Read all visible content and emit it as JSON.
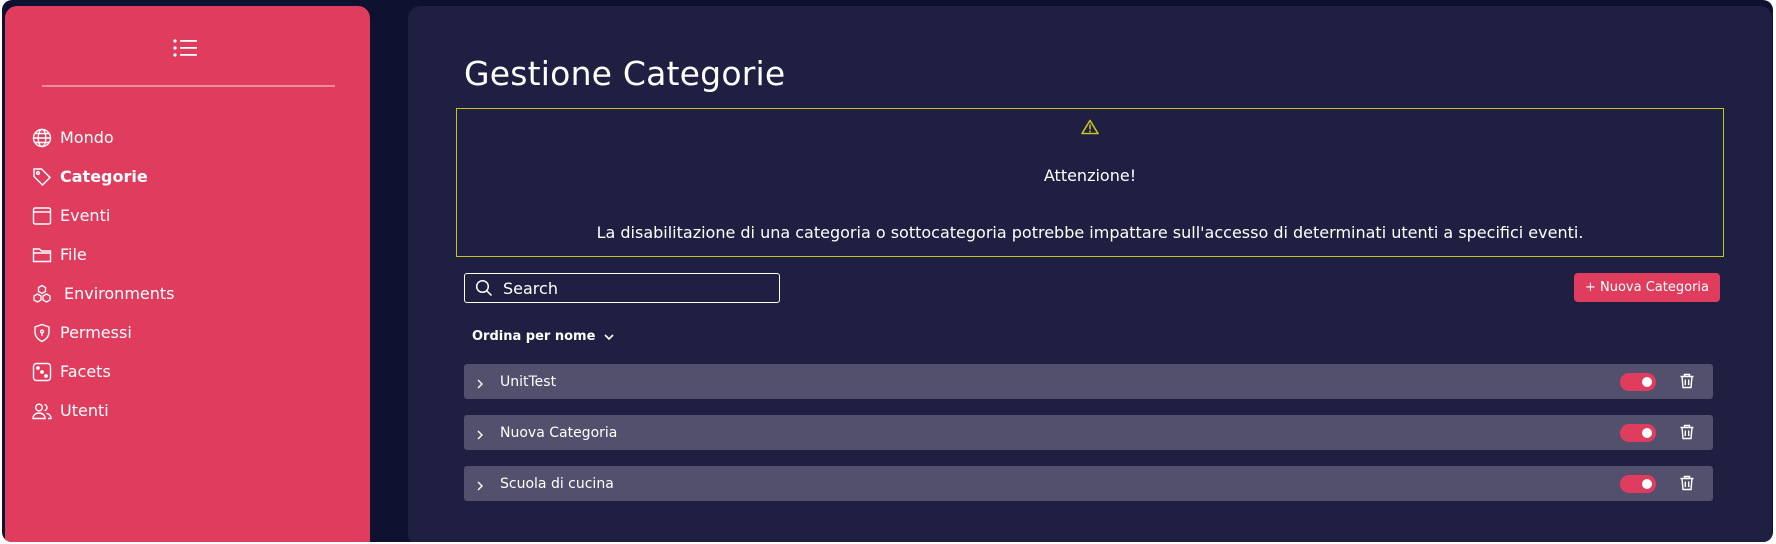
{
  "sidebar": {
    "items": [
      {
        "label": "Mondo",
        "icon": "globe-icon"
      },
      {
        "label": "Categorie",
        "icon": "tag-icon",
        "active": true
      },
      {
        "label": "Eventi",
        "icon": "calendar-icon"
      },
      {
        "label": "File",
        "icon": "folder-icon"
      },
      {
        "label": "Environments",
        "icon": "cubes-icon"
      },
      {
        "label": "Permessi",
        "icon": "shield-icon"
      },
      {
        "label": "Facets",
        "icon": "dice-icon"
      },
      {
        "label": "Utenti",
        "icon": "users-icon"
      }
    ]
  },
  "main": {
    "title": "Gestione Categorie",
    "alert": {
      "title": "Attenzione!",
      "text": "La disabilitazione di una categoria o sottocategoria potrebbe impattare sull'accesso di determinati utenti a specifici eventi."
    },
    "search": {
      "placeholder": "Search"
    },
    "new_button": "+ Nuova Categoria",
    "sort_label": "Ordina per nome",
    "categories": [
      {
        "name": "UnitTest",
        "enabled": true
      },
      {
        "name": "Nuova Categoria",
        "enabled": true
      },
      {
        "name": "Scuola di cucina",
        "enabled": true
      }
    ]
  },
  "colors": {
    "accent": "#df3c5e",
    "background": "#0f1131",
    "panel": "#1f2041",
    "row": "#52506d",
    "alert_border": "#c6c21e"
  }
}
